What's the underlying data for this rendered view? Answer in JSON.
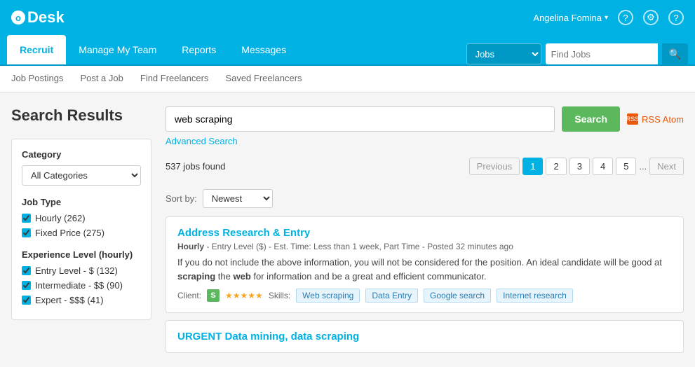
{
  "logo": {
    "symbol": "o",
    "name": "Desk",
    "full": "oDesk"
  },
  "topbar": {
    "username": "Angelina Fomina",
    "caret": "▾",
    "icons": [
      "?",
      "⚙",
      "?"
    ]
  },
  "navbar": {
    "tabs": [
      {
        "id": "recruit",
        "label": "Recruit",
        "active": true
      },
      {
        "id": "manage",
        "label": "Manage My Team",
        "active": false
      },
      {
        "id": "reports",
        "label": "Reports",
        "active": false
      },
      {
        "id": "messages",
        "label": "Messages",
        "active": false
      }
    ],
    "search": {
      "select_value": "Jobs",
      "input_placeholder": "Find Jobs",
      "btn_icon": "🔍"
    }
  },
  "subnav": {
    "items": [
      {
        "id": "job-postings",
        "label": "Job Postings",
        "active": false
      },
      {
        "id": "post-a-job",
        "label": "Post a Job",
        "active": false
      },
      {
        "id": "find-freelancers",
        "label": "Find Freelancers",
        "active": false
      },
      {
        "id": "saved-freelancers",
        "label": "Saved Freelancers",
        "active": false
      }
    ]
  },
  "page": {
    "title": "Search Results"
  },
  "sidebar": {
    "category_label": "Category",
    "category_value": "All Categories",
    "job_type_label": "Job Type",
    "job_types": [
      {
        "id": "hourly",
        "label": "Hourly",
        "count": "262",
        "checked": true
      },
      {
        "id": "fixed",
        "label": "Fixed Price",
        "count": "275",
        "checked": true
      }
    ],
    "experience_label": "Experience Level (hourly)",
    "experience_levels": [
      {
        "id": "entry",
        "label": "Entry Level - $",
        "count": "132",
        "checked": true
      },
      {
        "id": "intermediate",
        "label": "Intermediate - $$",
        "count": "90",
        "checked": true
      },
      {
        "id": "expert",
        "label": "Expert - $$$",
        "count": "41",
        "checked": true
      }
    ]
  },
  "search": {
    "query": "web scraping",
    "btn_label": "Search",
    "advanced_label": "Advanced Search",
    "rss_label": "RSS Atom"
  },
  "results": {
    "count_text": "537 jobs found",
    "sort_label": "Sort by:",
    "sort_value": "Newest",
    "pagination": {
      "prev_label": "Previous",
      "next_label": "Next",
      "pages": [
        "1",
        "2",
        "3",
        "4",
        "5"
      ],
      "ellipsis": "...",
      "active_page": "1"
    },
    "jobs": [
      {
        "id": "job1",
        "title": "Address Research & Entry",
        "meta": "Hourly - Entry Level ($) - Est. Time: Less than 1 week, Part Time - Posted 32 minutes ago",
        "description_parts": [
          "If you do not include the above information, you will not be considered for the position. An ideal candidate will be good at ",
          "scraping",
          " the ",
          "web",
          " for information and be a great and efficient communicator."
        ],
        "client_label": "Client:",
        "client_badge": "S",
        "stars": "★★★★★",
        "skills_label": "Skills:",
        "skills": [
          "Web scraping",
          "Data Entry",
          "Google search",
          "Internet research"
        ]
      },
      {
        "id": "job2",
        "title": "URGENT Data mining, data scraping",
        "meta": "",
        "description_parts": [],
        "skills": []
      }
    ]
  }
}
